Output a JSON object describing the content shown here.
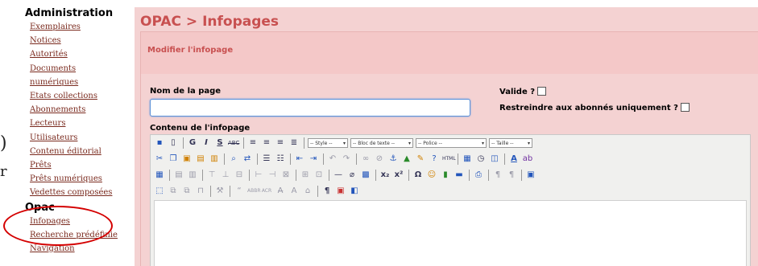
{
  "stray": {
    "glyph1": ")",
    "glyph2": "r"
  },
  "sidebar": {
    "administration_title": "Administration",
    "admin_items": [
      "Exemplaires",
      "Notices",
      "Autorités",
      "Documents",
      "numériques",
      "Etats collections",
      "Abonnements",
      "Lecteurs",
      "Utilisateurs",
      "Contenu éditorial",
      "Prêts",
      "Prêts numériques",
      "Vedettes composées"
    ],
    "opac_title": "Opac",
    "opac_items": [
      "Infopages",
      "Recherche prédéfinie",
      "Navigation"
    ]
  },
  "highlight_color": "#d40000",
  "main": {
    "heading": "OPAC > Infopages",
    "form_title": "Modifier l'infopage",
    "name_label": "Nom de la page",
    "name_value": "",
    "valid_label": "Valide ?",
    "valid_checked": false,
    "restrict_label": "Restreindre aux abonnés uniquement ?",
    "restrict_checked": false,
    "content_label": "Contenu de l'infopage"
  },
  "editor": {
    "style_select": "-- Style --",
    "block_select": "-- Bloc de texte --",
    "font_select": "-- Police --",
    "size_select": "-- Taille --",
    "content": ""
  },
  "colors": {
    "heading": "#c85050",
    "panel_bg": "#f4d2d2",
    "link": "#7a2a1e",
    "input_focus": "#5b8fd6"
  }
}
